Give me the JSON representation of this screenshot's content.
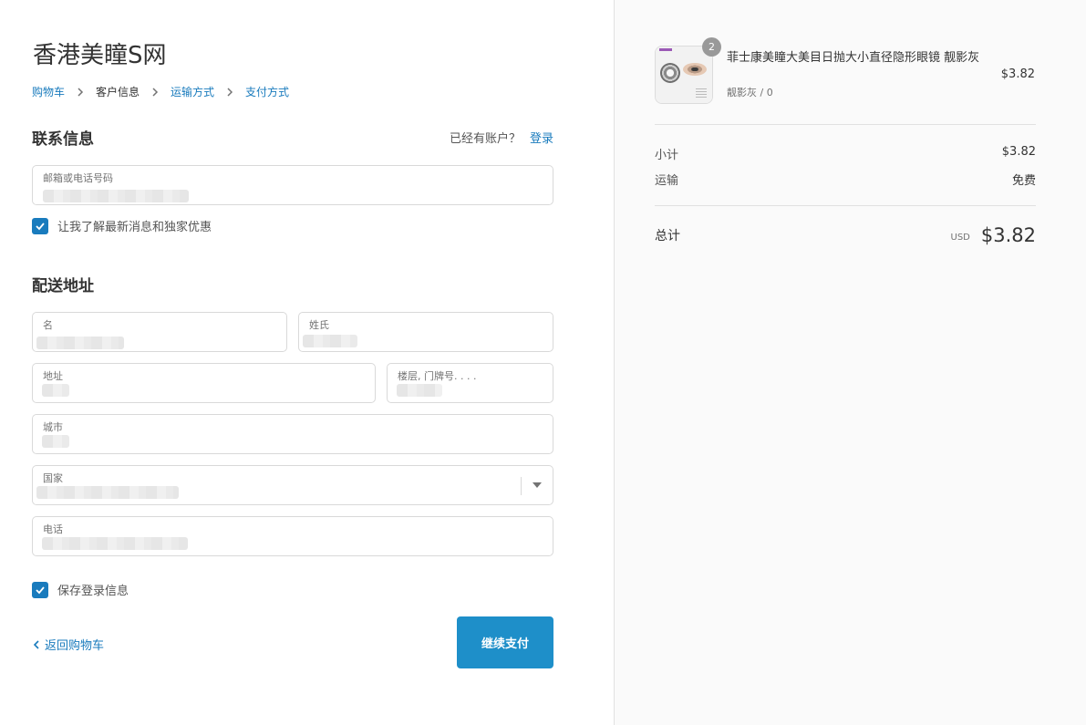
{
  "store": {
    "title": "香港美瞳S网"
  },
  "breadcrumb": {
    "items": [
      {
        "label": "购物车"
      },
      {
        "label": "客户信息"
      },
      {
        "label": "运输方式"
      },
      {
        "label": "支付方式"
      }
    ]
  },
  "contact": {
    "title": "联系信息",
    "have_account": "已经有账户？",
    "login_link": "登录",
    "email_label": "邮箱或电话号码",
    "marketing_label": "让我了解最新消息和独家优惠"
  },
  "shipping": {
    "title": "配送地址",
    "first_name_label": "名",
    "last_name_label": "姓氏",
    "address_label": "地址",
    "apartment_label": "楼层, 门牌号. . . .",
    "city_label": "城市",
    "country_label": "国家",
    "phone_label": "电话",
    "save_info_label": "保存登录信息"
  },
  "actions": {
    "back_label": "返回购物车",
    "continue_label": "继续支付"
  },
  "order": {
    "product": {
      "quantity": "2",
      "name": "菲士康美瞳大美目日抛大小直径隐形眼镜 靓影灰",
      "variant": "靓影灰 / 0",
      "price": "$3.82"
    },
    "subtotal_label": "小计",
    "subtotal_value": "$3.82",
    "shipping_label": "运输",
    "shipping_value": "免费",
    "total_label": "总计",
    "currency": "USD",
    "total_value": "$3.82"
  },
  "colors": {
    "accent": "#197bbd",
    "button": "#1e8fc9",
    "sidebar_bg": "#fafafa"
  }
}
